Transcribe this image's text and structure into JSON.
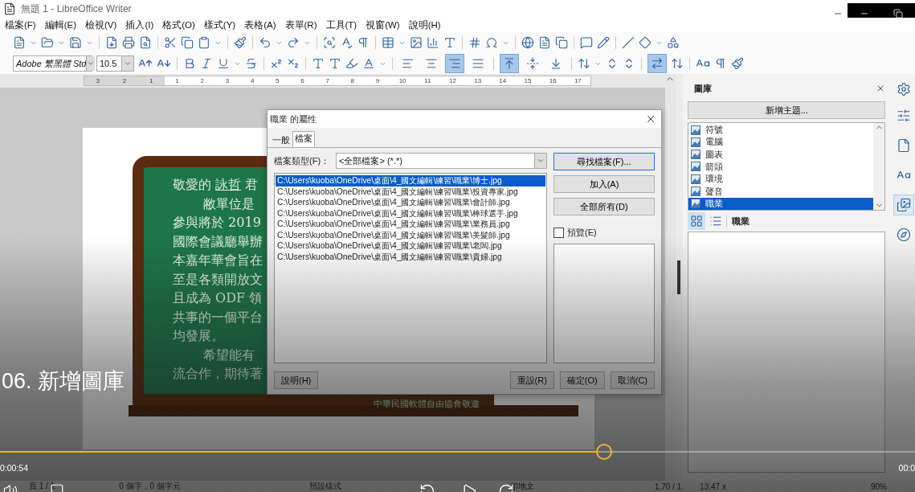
{
  "window": {
    "title": "無題 1 - LibreOffice Writer"
  },
  "menu": [
    "檔案(F)",
    "編輯(E)",
    "檢視(V)",
    "插入(I)",
    "格式(O)",
    "樣式(Y)",
    "表格(A)",
    "表單(R)",
    "工具(T)",
    "視窗(W)",
    "說明(H)"
  ],
  "format_bar": {
    "font": "Adobe 繁黑體 Std",
    "size": "10.5",
    "align_buttons": [
      {
        "kind": "left",
        "selected": false
      },
      {
        "kind": "center",
        "selected": false
      },
      {
        "kind": "right",
        "selected": true
      },
      {
        "kind": "justify",
        "selected": false
      }
    ],
    "vertical_buttons": [
      {
        "kind": "top",
        "selected": true
      },
      {
        "kind": "middle",
        "selected": false
      },
      {
        "kind": "bottom",
        "selected": false
      }
    ],
    "text_direction_on": true
  },
  "ruler": {
    "left_labels": [
      "3",
      "2",
      "1"
    ],
    "labels": [
      "1",
      "2",
      "3",
      "4",
      "5",
      "6",
      "7",
      "8",
      "9",
      "10",
      "11",
      "12",
      "13",
      "14",
      "15",
      "16",
      "17"
    ]
  },
  "document": {
    "greeting": {
      "before": "敬愛的",
      "name": "詠哲",
      "after": "君"
    },
    "board_lines": [
      {
        "text": "敝單位是",
        "indent": true
      },
      {
        "text": "參與將於 2019",
        "indent": false
      },
      {
        "text": "國際會議廳舉辦",
        "indent": false
      },
      {
        "text": "本嘉年華會旨在",
        "indent": false
      },
      {
        "text": "至是各類開放文",
        "indent": false
      },
      {
        "text": "且成為 ODF 領",
        "indent": false
      },
      {
        "text": "共事的一個平台",
        "indent": false
      },
      {
        "text": "均發展。",
        "indent": false
      },
      {
        "text": "希望能有",
        "indent": true
      },
      {
        "text": "流合作，期待著",
        "indent": false
      }
    ],
    "board_footer": "中華民國軟體自由協會敬邀"
  },
  "dialog": {
    "title": "職業 的屬性",
    "tabs": [
      {
        "label": "一般",
        "selected": false
      },
      {
        "label": "檔案",
        "selected": true
      }
    ],
    "file_type_label": "檔案類型(F)：",
    "file_type": "<全部檔案> (*.*)",
    "files": [
      {
        "path": "C:\\Users\\kuoba\\OneDrive\\桌面\\4_國文編輯\\練習\\職業\\博士.jpg",
        "selected": true
      },
      {
        "path": "C:\\Users\\kuoba\\OneDrive\\桌面\\4_國文編輯\\練習\\職業\\投資專家.jpg",
        "selected": false
      },
      {
        "path": "C:\\Users\\kuoba\\OneDrive\\桌面\\4_國文編輯\\練習\\職業\\會計師.jpg",
        "selected": false
      },
      {
        "path": "C:\\Users\\kuoba\\OneDrive\\桌面\\4_國文編輯\\練習\\職業\\棒球選手.jpg",
        "selected": false
      },
      {
        "path": "C:\\Users\\kuoba\\OneDrive\\桌面\\4_國文編輯\\練習\\職業\\業務員.jpg",
        "selected": false
      },
      {
        "path": "C:\\Users\\kuoba\\OneDrive\\桌面\\4_國文編輯\\練習\\職業\\美髮師.jpg",
        "selected": false
      },
      {
        "path": "C:\\Users\\kuoba\\OneDrive\\桌面\\4_國文編輯\\練習\\職業\\老闆.jpg",
        "selected": false
      },
      {
        "path": "C:\\Users\\kuoba\\OneDrive\\桌面\\4_國文編輯\\練習\\職業\\貴婦.jpg",
        "selected": false
      }
    ],
    "side_buttons": [
      "尋找檔案(F)...",
      "加入(A)",
      "全部所有(D)"
    ],
    "preview": {
      "label": "預覽(E)",
      "checked": false
    },
    "help_button": "說明(H)",
    "footer_buttons": [
      "重設(R)",
      "確定(O)",
      "取消(C)"
    ]
  },
  "gallery": {
    "title": "圖庫",
    "new_theme": "新增主題...",
    "themes": [
      {
        "label": "符號",
        "selected": false
      },
      {
        "label": "電腦",
        "selected": false
      },
      {
        "label": "圖表",
        "selected": false
      },
      {
        "label": "箭頭",
        "selected": false
      },
      {
        "label": "環境",
        "selected": false
      },
      {
        "label": "聲音",
        "selected": false
      },
      {
        "label": "職業",
        "selected": true
      }
    ],
    "view_buttons": [
      {
        "kind": "icons",
        "selected": true
      },
      {
        "kind": "details",
        "selected": false
      }
    ],
    "theme_name": "職業"
  },
  "deck_tabs": [
    {
      "kind": "properties",
      "selected": false
    },
    {
      "kind": "page",
      "selected": false
    },
    {
      "kind": "styles",
      "selected": false
    },
    {
      "kind": "gallery",
      "selected": true
    },
    {
      "kind": "navigator",
      "selected": false
    }
  ],
  "status_bar": [
    "頁 1 / 1",
    "0 個字，0 個字元",
    "預設樣式",
    "印地文",
    "1.70 / 1.",
    "13.47 x",
    "90%"
  ],
  "video": {
    "title": "06. 新增圖庫",
    "elapsed": "0:00:54",
    "remaining": "00:0",
    "progress": {
      "level": 0.66
    }
  }
}
